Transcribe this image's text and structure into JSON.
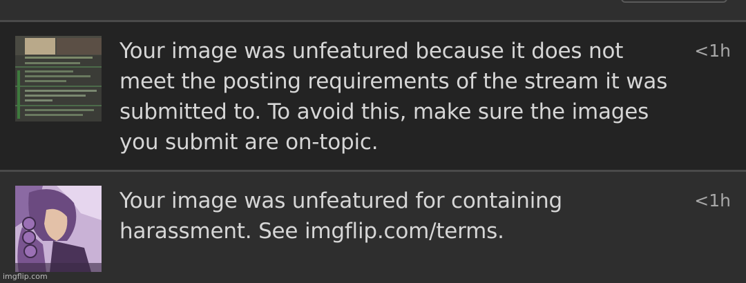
{
  "notifications": [
    {
      "message": "Your image was unfeatured because it does not meet the posting requirements of the stream it was submitted to. To avoid this, make sure the images you submit are on-topic.",
      "time": "<1h",
      "thumbnail_icon": "comment-screenshot-thumbnail"
    },
    {
      "message": "Your image was unfeatured for containing harassment. See imgflip.com/terms.",
      "time": "<1h",
      "thumbnail_icon": "anime-character-thumbnail"
    }
  ],
  "watermark": "imgflip.com",
  "colors": {
    "background": "#2d2d2d",
    "highlight_row": "#232323",
    "text": "#d6d6d6",
    "timestamp": "#a8a8a8"
  }
}
